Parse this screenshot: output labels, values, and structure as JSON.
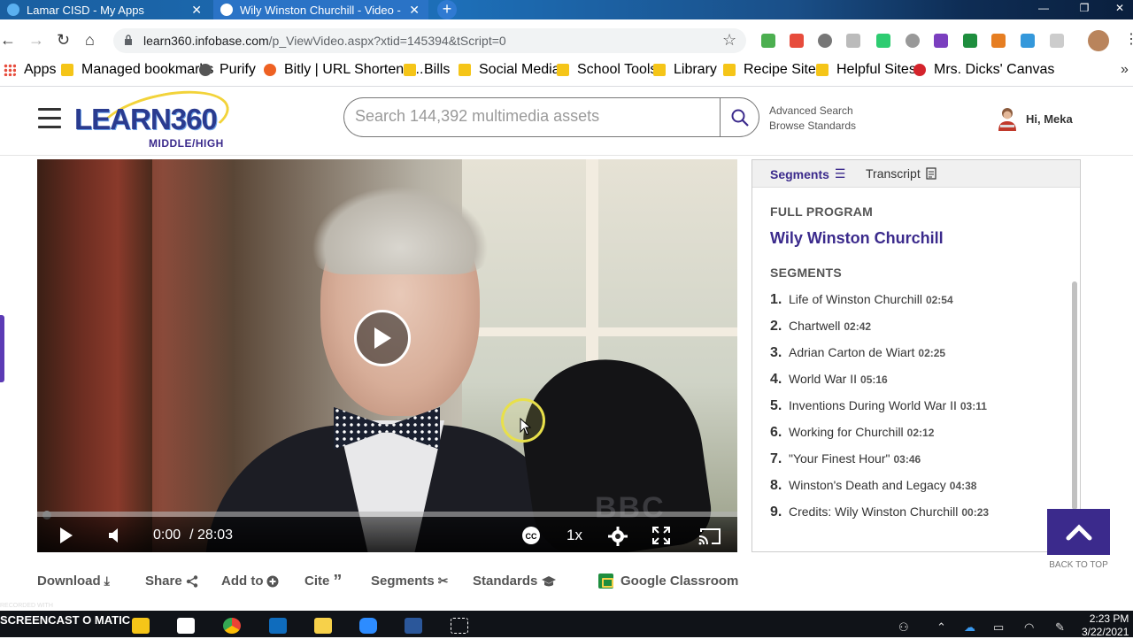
{
  "browser": {
    "tabs": [
      {
        "title": "Lamar CISD - My Apps",
        "active": false
      },
      {
        "title": "Wily Winston Churchill - Video -",
        "active": true
      }
    ],
    "url_domain": "learn360.infobase.com",
    "url_path": "/p_ViewVideo.aspx?xtid=145394&tScript=0",
    "bookmarks": [
      "Apps",
      "Managed bookmarks",
      "Purify",
      "Bitly | URL Shortene...",
      "Bills",
      "Social Media",
      "School Tools",
      "Library",
      "Recipe Sites",
      "Helpful Sites",
      "Mrs. Dicks' Canvas"
    ]
  },
  "header": {
    "logo_text": "LEARN360",
    "logo_sub": "MIDDLE/HIGH",
    "search_placeholder": "Search 144,392 multimedia assets",
    "advanced_search": "Advanced Search",
    "browse_standards": "Browse Standards",
    "greeting": "Hi, Meka"
  },
  "player": {
    "current_time": "0:00",
    "duration": "/ 28:03",
    "speed": "1x",
    "progress": 0,
    "watermark": "BBC"
  },
  "actions": [
    {
      "label": "Download",
      "icon": "download-icon"
    },
    {
      "label": "Share",
      "icon": "share-icon"
    },
    {
      "label": "Add to",
      "icon": "plus-circle-icon"
    },
    {
      "label": "Cite",
      "icon": "quote-icon"
    },
    {
      "label": "Segments",
      "icon": "scissors-icon"
    },
    {
      "label": "Standards",
      "icon": "graduation-cap-icon"
    },
    {
      "label": "Google Classroom",
      "icon": "google-classroom-icon"
    }
  ],
  "panel": {
    "tab_segments": "Segments",
    "tab_transcript": "Transcript",
    "full_program_label": "FULL PROGRAM",
    "program_title": "Wily Winston Churchill",
    "segments_label": "SEGMENTS",
    "segments": [
      {
        "num": "1.",
        "title": "Life of Winston Churchill",
        "duration": "02:54"
      },
      {
        "num": "2.",
        "title": "Chartwell",
        "duration": "02:42"
      },
      {
        "num": "3.",
        "title": "Adrian Carton de Wiart",
        "duration": "02:25"
      },
      {
        "num": "4.",
        "title": "World War II",
        "duration": "05:16"
      },
      {
        "num": "5.",
        "title": "Inventions During World War II",
        "duration": "03:11"
      },
      {
        "num": "6.",
        "title": "Working for Churchill",
        "duration": "02:12"
      },
      {
        "num": "7.",
        "title": "\"Your Finest Hour\"",
        "duration": "03:46"
      },
      {
        "num": "8.",
        "title": "Winston's Death and Legacy",
        "duration": "04:38"
      },
      {
        "num": "9.",
        "title": "Credits: Wily Winston Churchill",
        "duration": "00:23"
      }
    ]
  },
  "back_to_top": "BACK TO TOP",
  "taskbar": {
    "recorder_small": "RECORDED WITH",
    "recorder_big": "SCREENCAST O MATIC",
    "time": "2:23 PM",
    "date": "3/22/2021"
  },
  "colors": {
    "brand_purple": "#3b2a8c",
    "tab_blue": "#2a73c6"
  }
}
